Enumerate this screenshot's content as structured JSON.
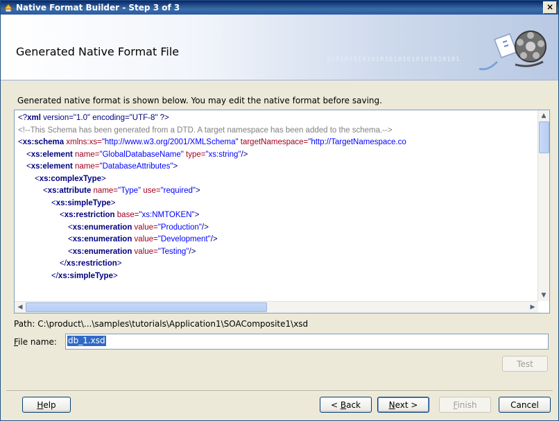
{
  "window": {
    "title": "Native Format Builder - Step 3 of 3",
    "close_glyph": "×"
  },
  "banner": {
    "title": "Generated Native Format File",
    "binary_text": "010101010101010101010101010101"
  },
  "instruction": "Generated native format is shown below. You may edit the native format before saving.",
  "code_lines": [
    {
      "indent": 0,
      "parts": [
        [
          "pi",
          "<?"
        ],
        [
          "pib",
          "xml"
        ],
        [
          "pi",
          " version=\"1.0\" encoding=\"UTF-8\" ?>"
        ]
      ]
    },
    {
      "indent": 0,
      "parts": [
        [
          "comment",
          "<!--This Schema has been generated from a DTD. A target namespace has been added to the schema.-->"
        ]
      ]
    },
    {
      "indent": 0,
      "parts": [
        [
          "punc",
          "<"
        ],
        [
          "tag",
          "xs:schema"
        ],
        [
          "attr",
          " xmlns:xs="
        ],
        [
          "val",
          "\"http://www.w3.org/2001/XMLSchema\""
        ],
        [
          "attr",
          " targetNamespace="
        ],
        [
          "val",
          "\"http://TargetNamespace.co"
        ]
      ]
    },
    {
      "indent": 1,
      "parts": [
        [
          "punc",
          "<"
        ],
        [
          "tag",
          "xs:element"
        ],
        [
          "attr",
          " name="
        ],
        [
          "val",
          "\"GlobalDatabaseName\""
        ],
        [
          "attr",
          " type="
        ],
        [
          "val",
          "\"xs:string\""
        ],
        [
          "punc",
          "/>"
        ]
      ]
    },
    {
      "indent": 1,
      "parts": [
        [
          "punc",
          "<"
        ],
        [
          "tag",
          "xs:element"
        ],
        [
          "attr",
          " name="
        ],
        [
          "val",
          "\"DatabaseAttributes\""
        ],
        [
          "punc",
          ">"
        ]
      ]
    },
    {
      "indent": 2,
      "parts": [
        [
          "punc",
          "<"
        ],
        [
          "tag",
          "xs:complexType"
        ],
        [
          "punc",
          ">"
        ]
      ]
    },
    {
      "indent": 3,
      "parts": [
        [
          "punc",
          "<"
        ],
        [
          "tag",
          "xs:attribute"
        ],
        [
          "attr",
          " name="
        ],
        [
          "val",
          "\"Type\""
        ],
        [
          "attr",
          " use="
        ],
        [
          "val",
          "\"required\""
        ],
        [
          "punc",
          ">"
        ]
      ]
    },
    {
      "indent": 4,
      "parts": [
        [
          "punc",
          "<"
        ],
        [
          "tag",
          "xs:simpleType"
        ],
        [
          "punc",
          ">"
        ]
      ]
    },
    {
      "indent": 5,
      "parts": [
        [
          "punc",
          "<"
        ],
        [
          "tag",
          "xs:restriction"
        ],
        [
          "attr",
          " base="
        ],
        [
          "val",
          "\"xs:NMTOKEN\""
        ],
        [
          "punc",
          ">"
        ]
      ]
    },
    {
      "indent": 6,
      "parts": [
        [
          "punc",
          "<"
        ],
        [
          "tag",
          "xs:enumeration"
        ],
        [
          "attr",
          " value="
        ],
        [
          "val",
          "\"Production\""
        ],
        [
          "punc",
          "/>"
        ]
      ]
    },
    {
      "indent": 6,
      "parts": [
        [
          "punc",
          "<"
        ],
        [
          "tag",
          "xs:enumeration"
        ],
        [
          "attr",
          " value="
        ],
        [
          "val",
          "\"Development\""
        ],
        [
          "punc",
          "/>"
        ]
      ]
    },
    {
      "indent": 6,
      "parts": [
        [
          "punc",
          "<"
        ],
        [
          "tag",
          "xs:enumeration"
        ],
        [
          "attr",
          " value="
        ],
        [
          "val",
          "\"Testing\""
        ],
        [
          "punc",
          "/>"
        ]
      ]
    },
    {
      "indent": 5,
      "parts": [
        [
          "punc",
          "</"
        ],
        [
          "tag",
          "xs:restriction"
        ],
        [
          "punc",
          ">"
        ]
      ]
    },
    {
      "indent": 4,
      "parts": [
        [
          "punc",
          "</"
        ],
        [
          "tag",
          "xs:simpleType"
        ],
        [
          "punc",
          ">"
        ]
      ]
    }
  ],
  "path_text": "Path: C:\\product\\...\\samples\\tutorials\\Application1\\SOAComposite1\\xsd",
  "file_name": {
    "label_first": "F",
    "label_rest": "ile name:",
    "value": "db_1.xsd"
  },
  "buttons": {
    "test": "Test",
    "help_first": "H",
    "help_rest": "elp",
    "back_prefix": "< ",
    "back_first": "B",
    "back_rest": "ack",
    "next_first": "N",
    "next_rest": "ext >",
    "finish_first": "F",
    "finish_rest": "inish",
    "cancel": "Cancel"
  },
  "colors": {
    "title_bar": "#0a246a",
    "selection": "#316ac5",
    "xml_tag": "#000080",
    "xml_attr": "#a0001e",
    "xml_value": "#0000ff",
    "xml_comment": "#808080"
  }
}
